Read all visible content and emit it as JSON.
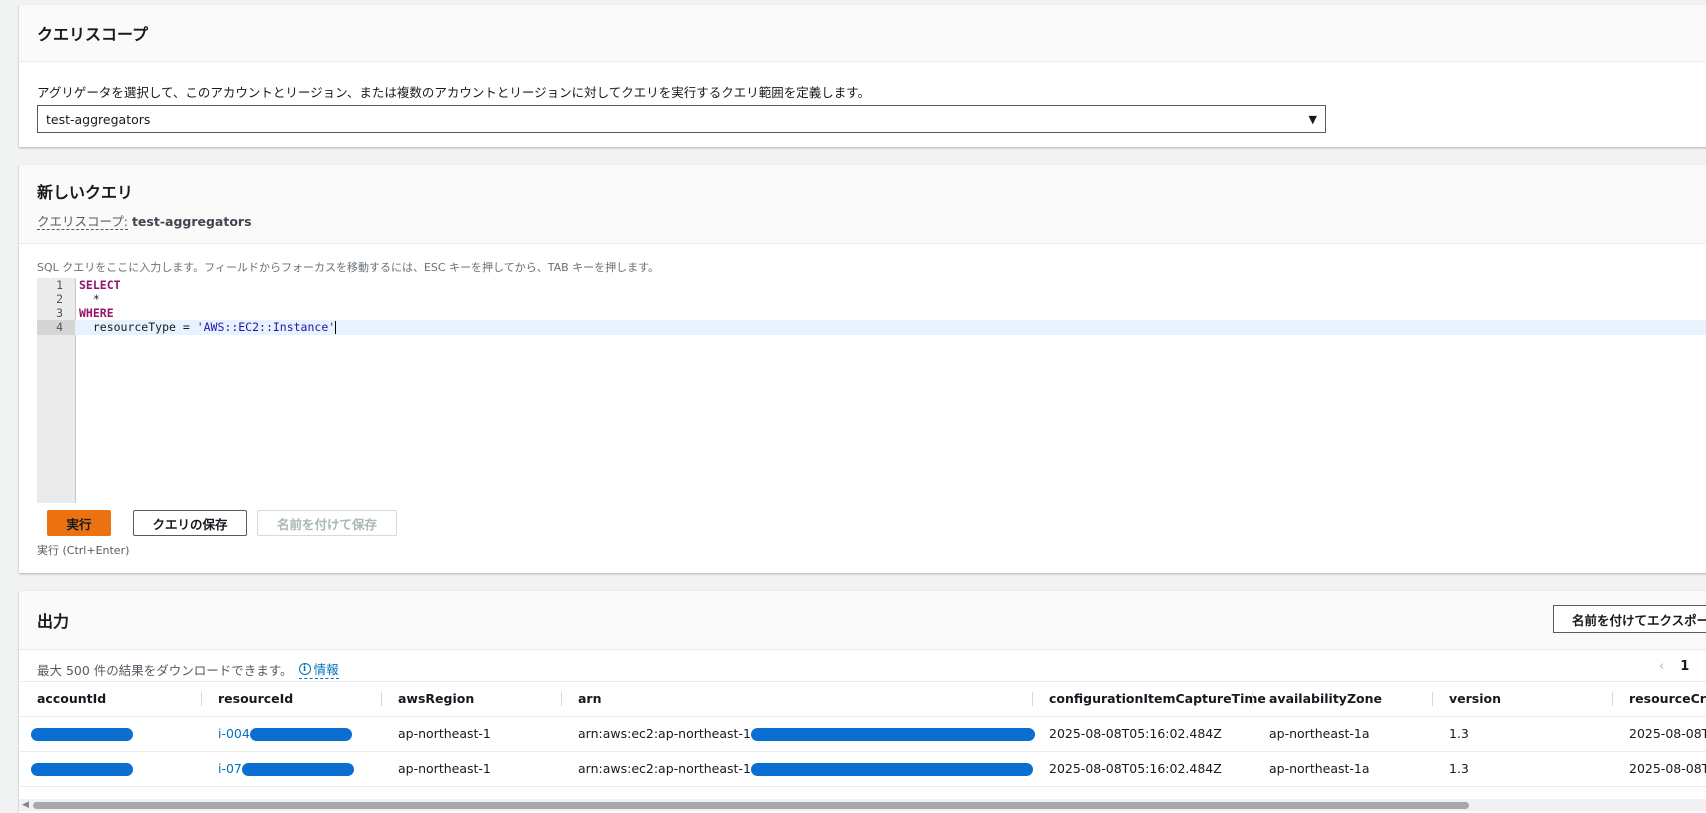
{
  "scope": {
    "title": "クエリスコープ",
    "description": "アグリゲータを選択して、このアカウントとリージョン、または複数のアカウントとリージョンに対してクエリを実行するクエリ範囲を定義します。",
    "selected": "test-aggregators",
    "caret_icon": "▼"
  },
  "query": {
    "title": "新しいクエリ",
    "scope_label": "クエリスコープ:",
    "scope_value": "test-aggregators",
    "hint": "SQL クエリをここに入力します。フィールドからフォーカスを移動するには、ESC キーを押してから、TAB キーを押します。",
    "lines": {
      "1": {
        "num": "1",
        "code": "SELECT"
      },
      "2": {
        "num": "2",
        "code": "  *"
      },
      "3": {
        "num": "3",
        "code": "WHERE"
      },
      "4": {
        "num": "4",
        "lhs": "  resourceType = ",
        "str": "'AWS::EC2::Instance'"
      }
    },
    "run_label": "実行",
    "save_label": "クエリの保存",
    "save_as_label": "名前を付けて保存",
    "run_hint": "実行 (Ctrl+Enter)"
  },
  "output": {
    "title": "出力",
    "export_label": "名前を付けてエクスポート",
    "description": "最大 500 件の結果をダウンロードできます。",
    "info_label": "情報",
    "info_icon": "i",
    "prev_icon": "‹",
    "page": "1",
    "columns": {
      "c0": "accountId",
      "c1": "resourceId",
      "c2": "awsRegion",
      "c3": "arn",
      "c4": "configurationItemCaptureTime",
      "c5": "availabilityZone",
      "c6": "version",
      "c7": "resourceCreationTime"
    },
    "rows": {
      "r0": {
        "resourceId": "i-004",
        "awsRegion": "ap-northeast-1",
        "arn": "arn:aws:ec2:ap-northeast-1",
        "captureTime": "2025-08-08T05:16:02.484Z",
        "az": "ap-northeast-1a",
        "version": "1.3",
        "creation": "2025-08-08T"
      },
      "r1": {
        "resourceId": "i-07",
        "awsRegion": "ap-northeast-1",
        "arn": "arn:aws:ec2:ap-northeast-1",
        "captureTime": "2025-08-08T05:16:02.484Z",
        "az": "ap-northeast-1a",
        "version": "1.3",
        "creation": "2025-08-08T"
      }
    },
    "redaction_color": "#0a6fd1"
  },
  "colors": {
    "primary_button": "#ec7211",
    "link": "#0073bb"
  }
}
